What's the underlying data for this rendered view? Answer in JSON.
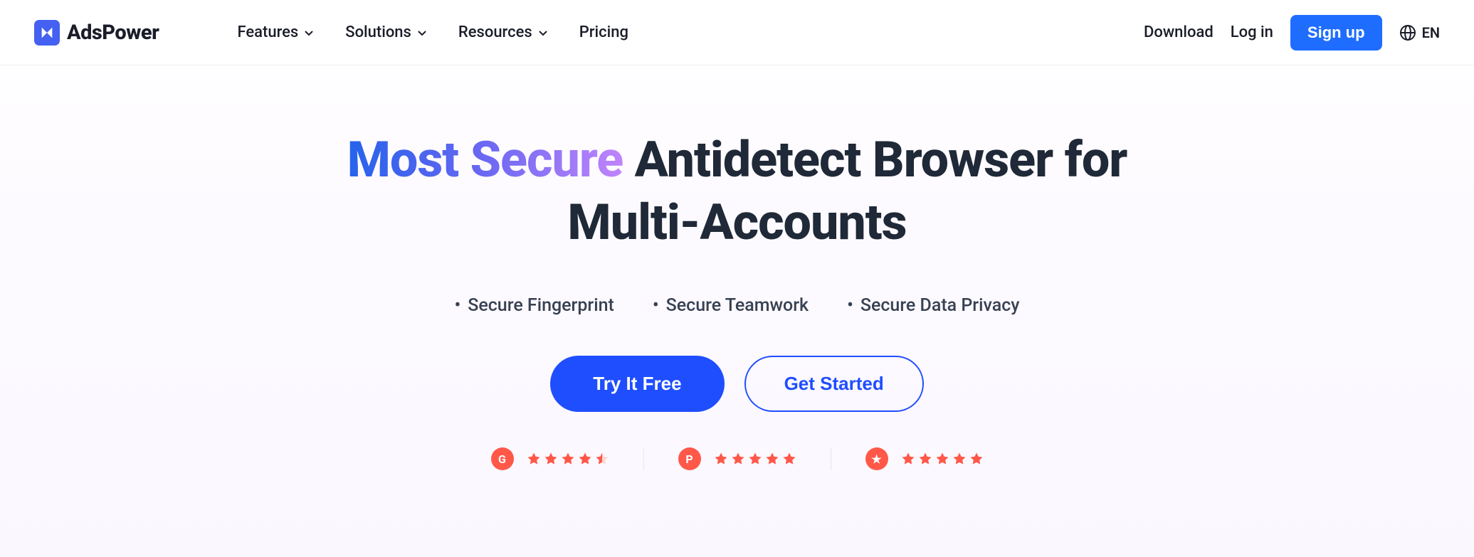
{
  "brand": {
    "name": "AdsPower"
  },
  "nav": {
    "items": [
      {
        "label": "Features",
        "hasDropdown": true
      },
      {
        "label": "Solutions",
        "hasDropdown": true
      },
      {
        "label": "Resources",
        "hasDropdown": true
      },
      {
        "label": "Pricing",
        "hasDropdown": false
      }
    ]
  },
  "auth": {
    "download": "Download",
    "login": "Log in",
    "signup": "Sign up"
  },
  "language": {
    "code": "EN"
  },
  "hero": {
    "title_gradient": "Most Secure",
    "title_rest_line1": " Antidetect Browser for",
    "title_line2": "Multi-Accounts"
  },
  "features": [
    "Secure Fingerprint",
    "Secure Teamwork",
    "Secure Data Privacy"
  ],
  "cta": {
    "primary": "Try It Free",
    "secondary": "Get Started"
  },
  "ratings": [
    {
      "brand": "G2",
      "badge_letter": "G",
      "stars": 4.5
    },
    {
      "brand": "ProductHunt",
      "badge_letter": "P",
      "stars": 5
    },
    {
      "brand": "Trustpilot",
      "badge_letter": "★",
      "stars": 5
    }
  ],
  "colors": {
    "primary_blue": "#1f4eff",
    "accent_orange": "#ff5849",
    "text_dark": "#1f2937"
  }
}
